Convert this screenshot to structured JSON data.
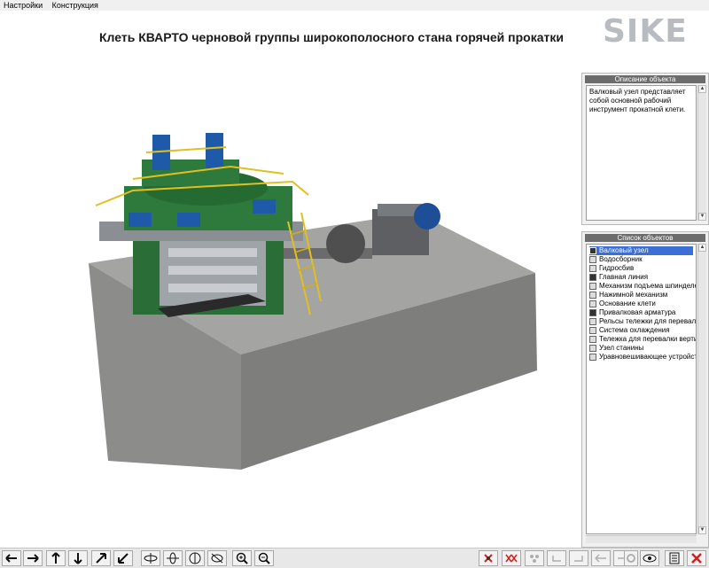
{
  "menu": {
    "items": [
      "Настройки",
      "Конструкция"
    ]
  },
  "header": {
    "title": "Клеть КВАРТО черновой группы широкополосного стана горячей прокатки",
    "logo_text": "SIKE"
  },
  "description_panel": {
    "title": "Описание объекта",
    "text": "Валковый узел представляет собой основной рабочий инструмент прокатной клети."
  },
  "objects_panel": {
    "title": "Список объектов",
    "items": [
      {
        "label": "Валковый узел",
        "checked": true,
        "selected": true
      },
      {
        "label": "Водосборник",
        "checked": false
      },
      {
        "label": "Гидросбив",
        "checked": false
      },
      {
        "label": "Главная линия",
        "checked": true
      },
      {
        "label": "Механизм подъема шпинделей",
        "checked": false
      },
      {
        "label": "Нажимной механизм",
        "checked": false
      },
      {
        "label": "Основание клети",
        "checked": false
      },
      {
        "label": "Привалковая арматура",
        "checked": true
      },
      {
        "label": "Рельсы тележки для перевалки г",
        "checked": false
      },
      {
        "label": "Система охлаждения",
        "checked": false
      },
      {
        "label": "Тележка для перевалки вертикал",
        "checked": false
      },
      {
        "label": "Узел станины",
        "checked": false
      },
      {
        "label": "Уравновешивающее устройство",
        "checked": false
      }
    ]
  },
  "toolbar": {
    "left_icons": [
      "arrow-left-icon",
      "arrow-right-icon",
      "arrow-up-icon",
      "arrow-down-icon",
      "diagonal-up-icon",
      "diagonal-down-icon",
      "rotate-x-icon",
      "rotate-y-icon",
      "rotate-z-icon",
      "rotate-free-icon",
      "zoom-in-icon",
      "zoom-out-icon"
    ],
    "right_icons": [
      "hide-object-icon",
      "hide-group-icon",
      "show-all-icon",
      "undo-icon",
      "redo-icon",
      "back-icon",
      "forward-icon",
      "settings-icon",
      "view-icon",
      "list-icon",
      "close-icon"
    ]
  },
  "colors": {
    "machine_green": "#2e7a3c",
    "motor_blue": "#1e5aa8",
    "railing_yellow": "#e0c020",
    "foundation_gray": "#9a9a98",
    "selection_blue": "#3b6fd6",
    "close_red": "#d02020"
  }
}
